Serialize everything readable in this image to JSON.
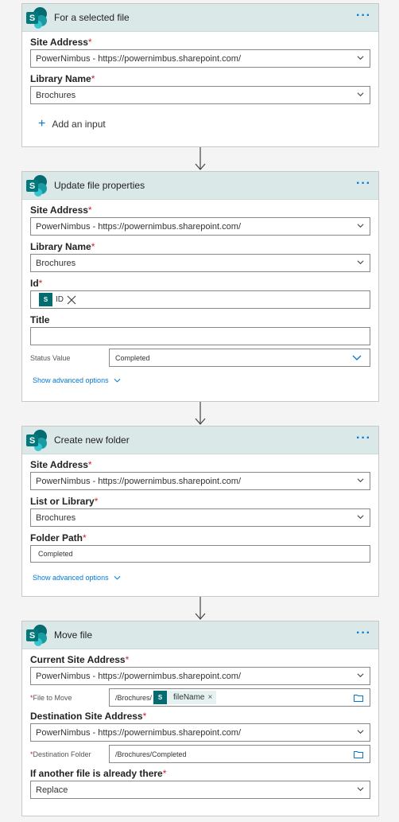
{
  "cards": [
    {
      "title": "For a selected file",
      "site_label": "Site Address",
      "site_value": "PowerNimbus - https://powernimbus.sharepoint.com/",
      "library_label": "Library Name",
      "library_value": "Brochures",
      "add_input": "Add an input"
    },
    {
      "title": "Update file properties",
      "site_label": "Site Address",
      "site_value": "PowerNimbus - https://powernimbus.sharepoint.com/",
      "library_label": "Library Name",
      "library_value": "Brochures",
      "id_label": "Id",
      "id_token": "ID",
      "title_label": "Title",
      "title_value": "",
      "status_label": "Status Value",
      "status_value": "Completed",
      "advanced": "Show advanced options"
    },
    {
      "title": "Create new folder",
      "site_label": "Site Address",
      "site_value": "PowerNimbus - https://powernimbus.sharepoint.com/",
      "library_label": "List or Library",
      "library_value": "Brochures",
      "folder_label": "Folder Path",
      "folder_value": "Completed",
      "advanced": "Show advanced options"
    },
    {
      "title": "Move file",
      "current_site_label": "Current Site Address",
      "current_site_value": "PowerNimbus - https://powernimbus.sharepoint.com/",
      "file_label": "File to Move",
      "file_prefix": "/Brochures/",
      "file_token": "fileName",
      "dest_site_label": "Destination Site Address",
      "dest_site_value": "PowerNimbus - https://powernimbus.sharepoint.com/",
      "dest_folder_label": "Destination Folder",
      "dest_folder_value": "/Brochures/Completed",
      "conflict_label": "If another file is already there",
      "conflict_value": "Replace"
    }
  ],
  "icons": {
    "connector": "sharepoint-icon",
    "menu": "more-options-icon",
    "dropdown": "chevron-down-icon",
    "folder": "folder-icon",
    "add": "plus-icon",
    "remove": "close-icon",
    "connector_arrow": "arrow-down-icon"
  },
  "colors": {
    "accent": "#0078d4",
    "header_bg": "#dbe8e8",
    "required": "#c4262e",
    "sharepoint": "#036c70"
  }
}
